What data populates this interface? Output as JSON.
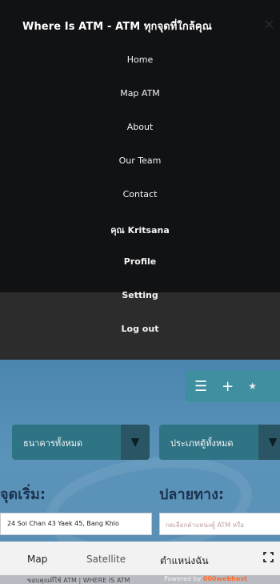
{
  "app": {
    "title": "Where Is ATM - ATM ทุกจุดที่ใกล้คุณ",
    "close_icon": "×"
  },
  "nav": {
    "items": [
      {
        "label": "Home"
      },
      {
        "label": "Map ATM"
      },
      {
        "label": "About"
      },
      {
        "label": "Our Team"
      },
      {
        "label": "Contact"
      },
      {
        "label": "คุณ Kritsana"
      },
      {
        "label": "Profile"
      },
      {
        "label": "Setting"
      },
      {
        "label": "Log out"
      }
    ]
  },
  "toolbar": {
    "menu_icon": "☰",
    "add_icon": "+",
    "star_icon": "★"
  },
  "filters": {
    "bank_select": "ธนาคารทั้งหมด",
    "atm_type_select": "ประเภทตู้ทั้งหมด",
    "dropdown_arrow": "▼"
  },
  "route": {
    "start_label": "จุดเริ่ม:",
    "end_label": "ปลายทาง:",
    "start_value": "24 Soi Chan 43 Yaek 45, Bang Khlo",
    "end_placeholder": "กดเลือกตำแหน่งตู้ ATM หรือ"
  },
  "map": {
    "tabs": [
      "Map",
      "Satellite",
      "ตำแหน่งฉัน"
    ],
    "footer": "ขอบคุณที่ใช้ ATM | WHERE IS ATM",
    "powered": "Powered by",
    "host": "000webhost"
  },
  "colors": {
    "drawer": "#111214",
    "drawer_footer": "#2c2c2c",
    "map_blue": "#5b93ba",
    "accent_teal": "#3f8fa0",
    "select_bg": "#2f7485",
    "label_navy": "#1d3350"
  }
}
